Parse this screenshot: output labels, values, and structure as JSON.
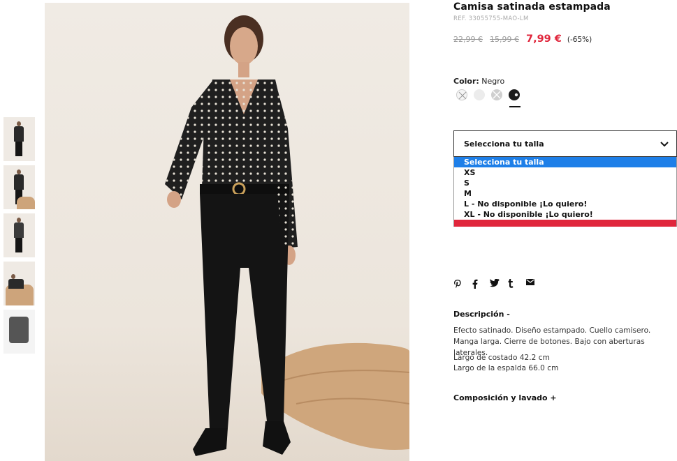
{
  "product": {
    "title": "Camisa satinada estampada",
    "ref": "REF. 33055755-MAO-LM",
    "price_old_1": "22,99 €",
    "price_old_2": "15,99 €",
    "price_now": "7,99 €",
    "discount": "(-65%)"
  },
  "color": {
    "label": "Color:",
    "value": "Negro",
    "swatches": [
      "white-swatch-unavailable",
      "light-grey-swatch",
      "grey-swatch-unavailable",
      "black-swatch-selected"
    ]
  },
  "size": {
    "select_label": "Selecciona tu talla",
    "options": [
      "Selecciona tu talla",
      "XS",
      "S",
      "M",
      "L - No disponible ¡Lo quiero!",
      "XL - No disponible ¡Lo quiero!"
    ],
    "selected_index": 0
  },
  "social": {
    "icons": [
      "pinterest-icon",
      "facebook-icon",
      "twitter-icon",
      "tumblr-icon",
      "email-icon"
    ]
  },
  "description": {
    "heading": "Descripción -",
    "text": "Efecto satinado. Diseño estampado. Cuello camisero. Manga larga. Cierre de botones. Bajo con aberturas laterales.",
    "measure_1": "Largo de costado 42.2 cm",
    "measure_2": "Largo de la espalda 66.0 cm"
  },
  "composition": {
    "heading": "Composición y lavado +"
  },
  "colors": {
    "accent_red": "#e0263c",
    "select_blue": "#1e7fe8"
  }
}
